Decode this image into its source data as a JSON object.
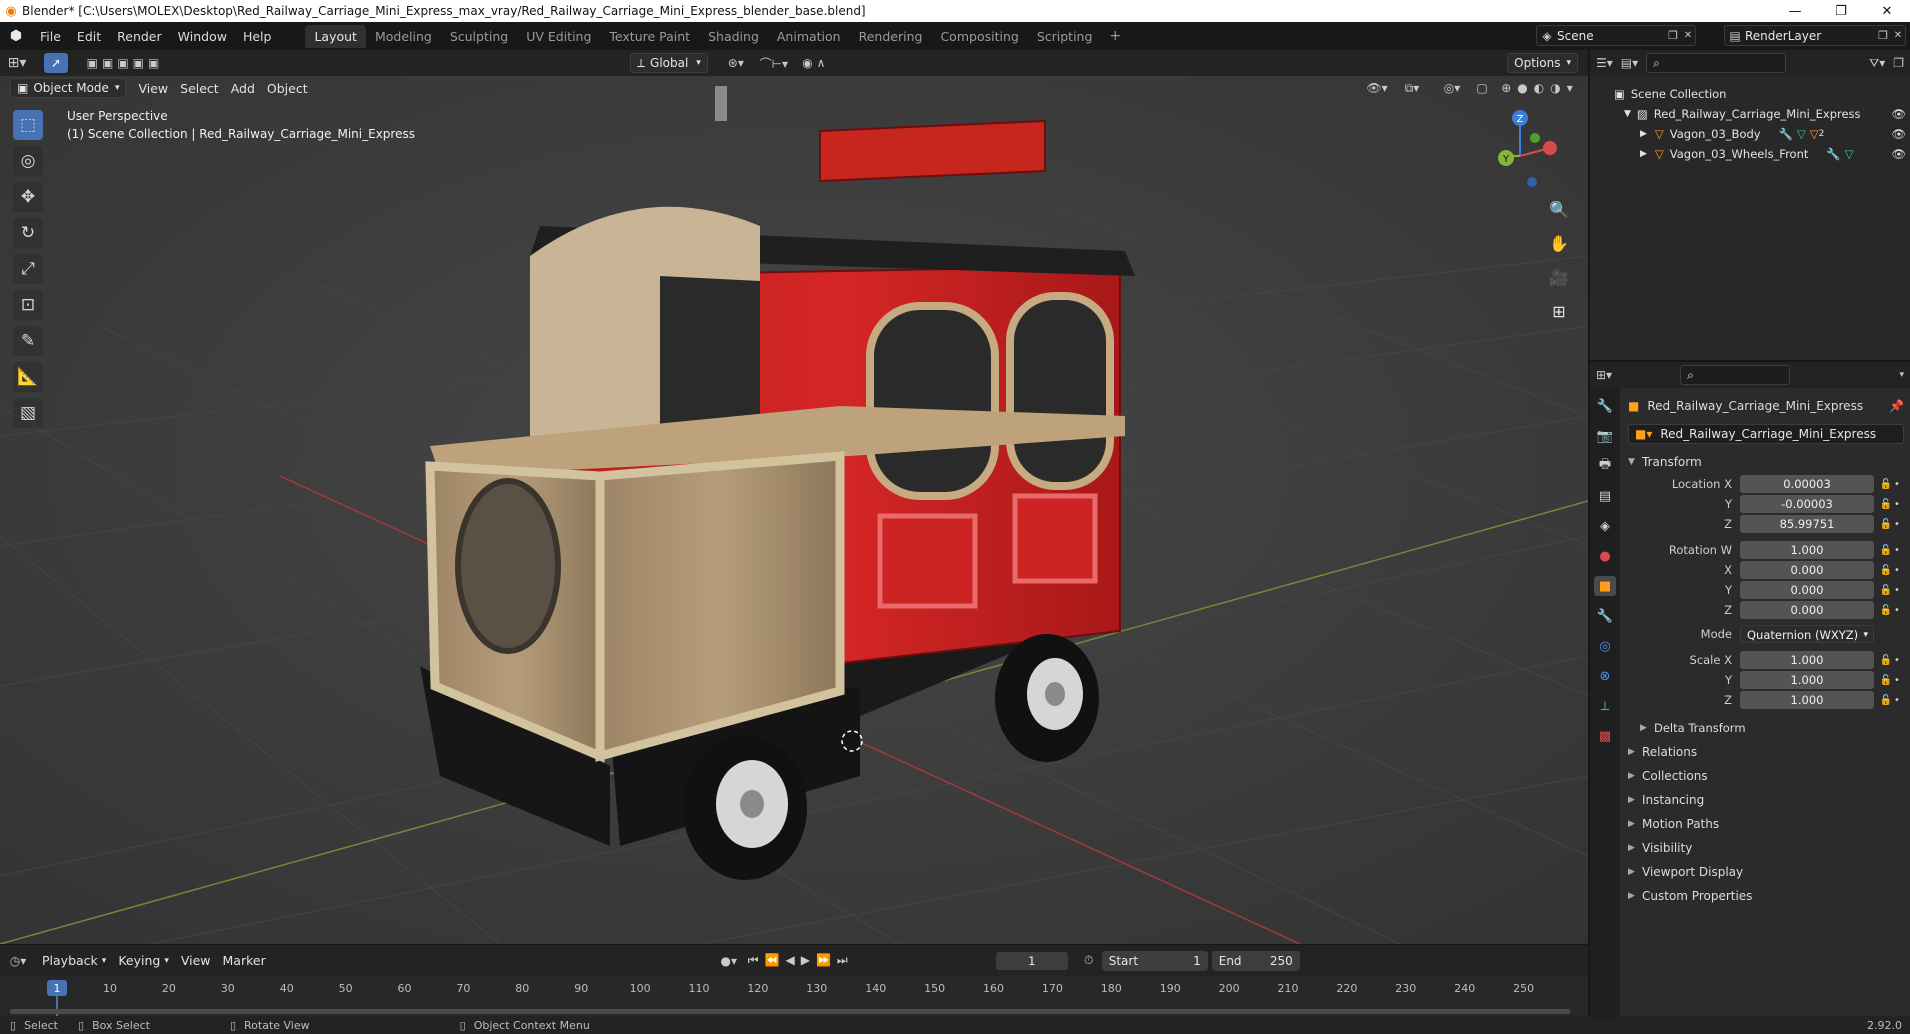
{
  "window": {
    "title": "Blender* [C:\\Users\\MOLEX\\Desktop\\Red_Railway_Carriage_Mini_Express_max_vray/Red_Railway_Carriage_Mini_Express_blender_base.blend]",
    "minimize": "—",
    "maximize": "❐",
    "close": "✕"
  },
  "menu": [
    "File",
    "Edit",
    "Render",
    "Window",
    "Help"
  ],
  "workspaces": {
    "active": "Layout",
    "tabs": [
      "Layout",
      "Modeling",
      "Sculpting",
      "UV Editing",
      "Texture Paint",
      "Shading",
      "Animation",
      "Rendering",
      "Compositing",
      "Scripting"
    ],
    "add": "+"
  },
  "scene": {
    "name": "Scene",
    "render_layer": "RenderLayer"
  },
  "viewport_header": {
    "transform_orientation": "Global",
    "options": "Options",
    "mode": "Object Mode",
    "menus": [
      "View",
      "Select",
      "Add",
      "Object"
    ]
  },
  "viewport": {
    "perspective": "User Perspective",
    "collection_info": "(1) Scene Collection | Red_Railway_Carriage_Mini_Express",
    "gizmo": {
      "z": "Z",
      "y": "Y"
    }
  },
  "outliner": {
    "root": "Scene Collection",
    "items": [
      {
        "name": "Red_Railway_Carriage_Mini_Express",
        "level": 1
      },
      {
        "name": "Vagon_03_Body",
        "level": 2
      },
      {
        "name": "Vagon_03_Wheels_Front",
        "level": 2
      }
    ],
    "badge": "2"
  },
  "properties": {
    "object_name": "Red_Railway_Carriage_Mini_Express",
    "object_field": "Red_Railway_Carriage_Mini_Express",
    "transform_title": "Transform",
    "location_label": "Location X",
    "location": [
      "0.00003",
      "-0.00003",
      "85.99751"
    ],
    "rotation_label": "Rotation W",
    "rotation": [
      "1.000",
      "0.000",
      "0.000",
      "0.000"
    ],
    "axis_labels": [
      "Y",
      "Z",
      "X"
    ],
    "mode_label": "Mode",
    "mode_value": "Quaternion (WXYZ)",
    "scale_label": "Scale X",
    "scale": [
      "1.000",
      "1.000",
      "1.000"
    ],
    "delta": "Delta Transform",
    "sections": [
      "Relations",
      "Collections",
      "Instancing",
      "Motion Paths",
      "Visibility",
      "Viewport Display",
      "Custom Properties"
    ]
  },
  "timeline": {
    "menus": [
      "Playback",
      "Keying",
      "View",
      "Marker"
    ],
    "current_frame": "1",
    "start_label": "Start",
    "start": "1",
    "end_label": "End",
    "end": "250",
    "ticks": [
      "10",
      "20",
      "30",
      "40",
      "50",
      "60",
      "70",
      "80",
      "90",
      "100",
      "110",
      "120",
      "130",
      "140",
      "150",
      "160",
      "170",
      "180",
      "190",
      "200",
      "210",
      "220",
      "230",
      "240",
      "250"
    ],
    "marker": "1"
  },
  "status": {
    "select": "Select",
    "box_select": "Box Select",
    "rotate": "Rotate View",
    "context": "Object Context Menu",
    "version": "2.92.0"
  },
  "colors": {
    "accent": "#4772b3",
    "orange": "#e87d0d",
    "selected": "#ff9f1a"
  }
}
